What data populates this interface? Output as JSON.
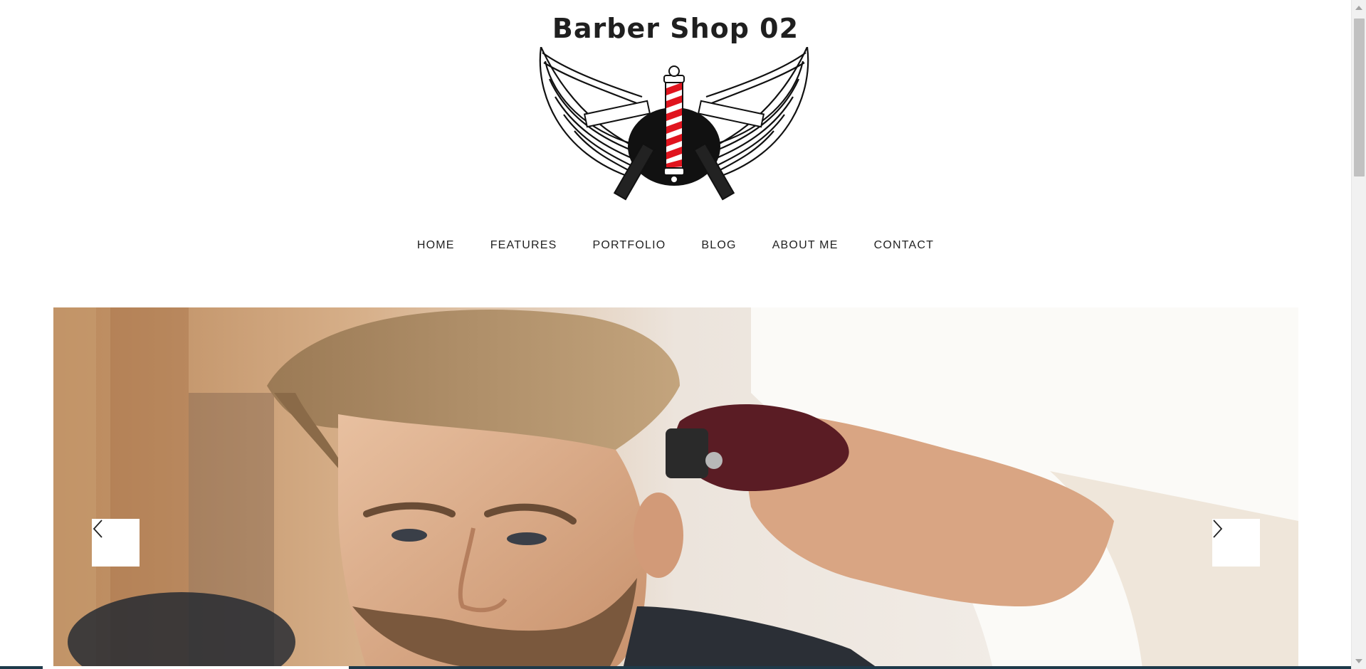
{
  "header": {
    "site_title": "Barber Shop 02",
    "logo_icon": "barber-pole-winged-razors-logo"
  },
  "nav": {
    "items": [
      {
        "label": "HOME"
      },
      {
        "label": "FEATURES"
      },
      {
        "label": "PORTFOLIO"
      },
      {
        "label": "BLOG"
      },
      {
        "label": "ABOUT ME"
      },
      {
        "label": "CONTACT"
      }
    ]
  },
  "slider": {
    "image_icon": "barber-haircut-photo",
    "prev_icon": "chevron-left-icon",
    "next_icon": "chevron-right-icon"
  },
  "colors": {
    "text": "#222222",
    "pole_red": "#e0141e",
    "accent_bar": "#1e3a4a"
  }
}
